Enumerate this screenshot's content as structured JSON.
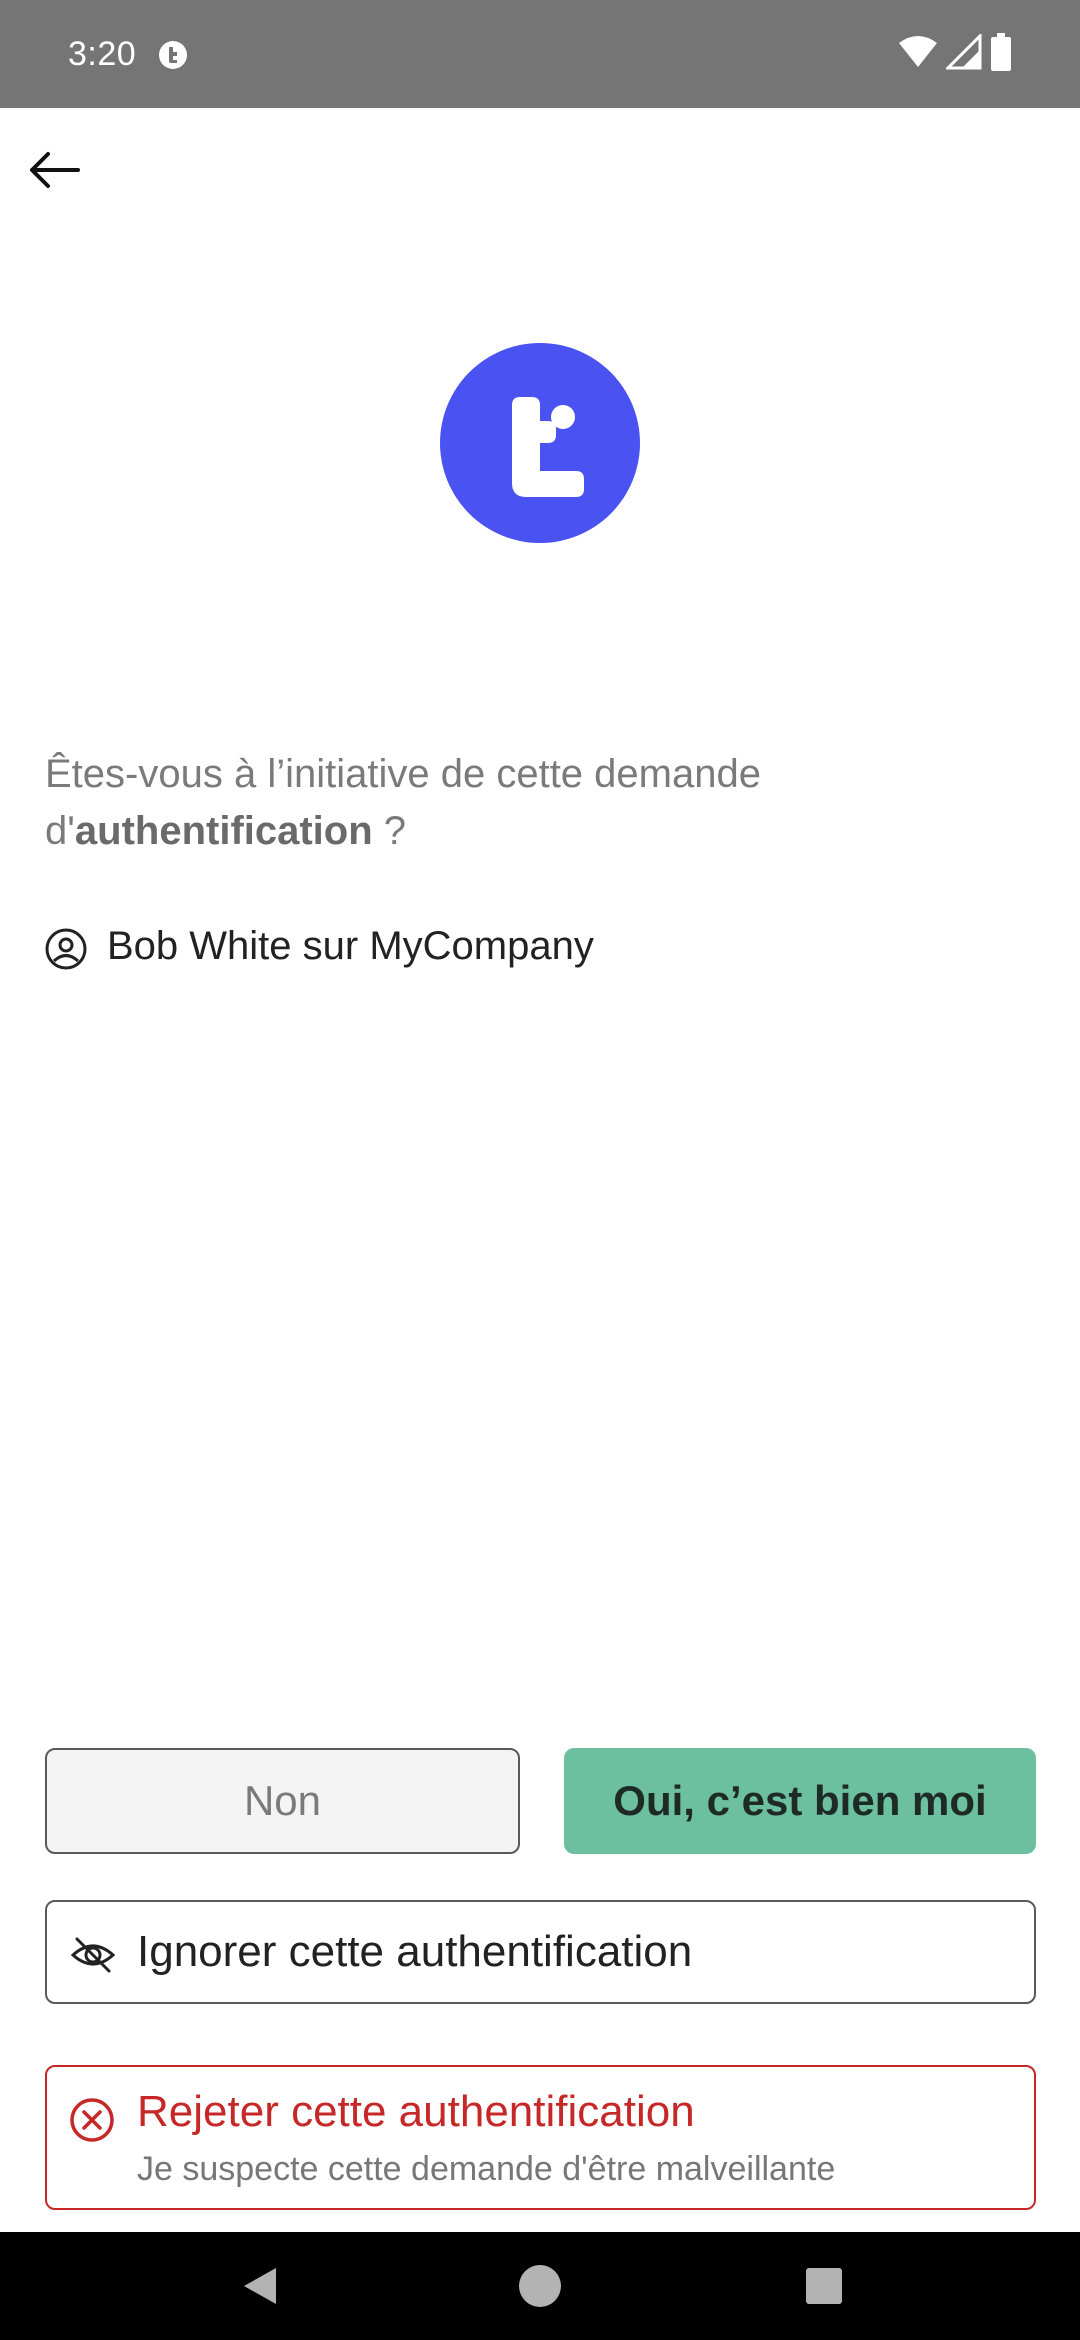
{
  "status_bar": {
    "time": "3:20",
    "app_icon": "notification-app-icon",
    "icons": [
      "wifi-icon",
      "signal-icon",
      "battery-icon"
    ]
  },
  "header": {
    "back_icon": "arrow-left-icon"
  },
  "logo": {
    "icon": "app-logo-t",
    "color": "#4a53f2"
  },
  "question": {
    "prefix": "Êtes-vous à l’initiative de cette demande d'",
    "bold": "authentification",
    "suffix": " ?"
  },
  "account": {
    "icon": "user-circle-icon",
    "label": "Bob White sur MyCompany"
  },
  "actions": {
    "no_label": "Non",
    "yes_label": "Oui, c’est bien moi",
    "ignore_label": "Ignorer cette authentification",
    "ignore_icon": "eye-off-icon",
    "reject_title": "Rejeter cette authentification",
    "reject_subtitle": "Je suspecte cette demande d'être malveillante",
    "reject_icon": "x-circle-icon"
  },
  "colors": {
    "accent": "#6cbf9f",
    "danger": "#c62828",
    "brand": "#4a53f2"
  },
  "nav_bar": {
    "icons": [
      "nav-back-icon",
      "nav-home-icon",
      "nav-recents-icon"
    ]
  }
}
